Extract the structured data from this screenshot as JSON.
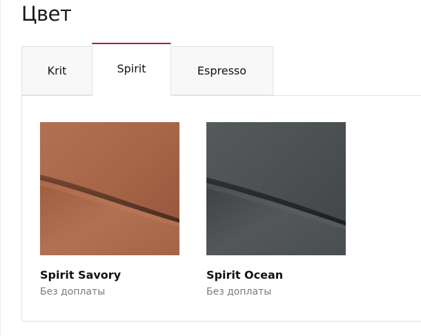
{
  "section": {
    "title": "Цвет"
  },
  "tabs": [
    {
      "label": "Krit",
      "active": false
    },
    {
      "label": "Spirit",
      "active": true
    },
    {
      "label": "Espresso",
      "active": false
    }
  ],
  "accent_color": "#b0154a",
  "swatches": [
    {
      "name": "Spirit Savory",
      "price": "Без доплаты",
      "color": "#a65a3a"
    },
    {
      "name": "Spirit Ocean",
      "price": "Без доплаты",
      "color": "#3c4042"
    }
  ]
}
